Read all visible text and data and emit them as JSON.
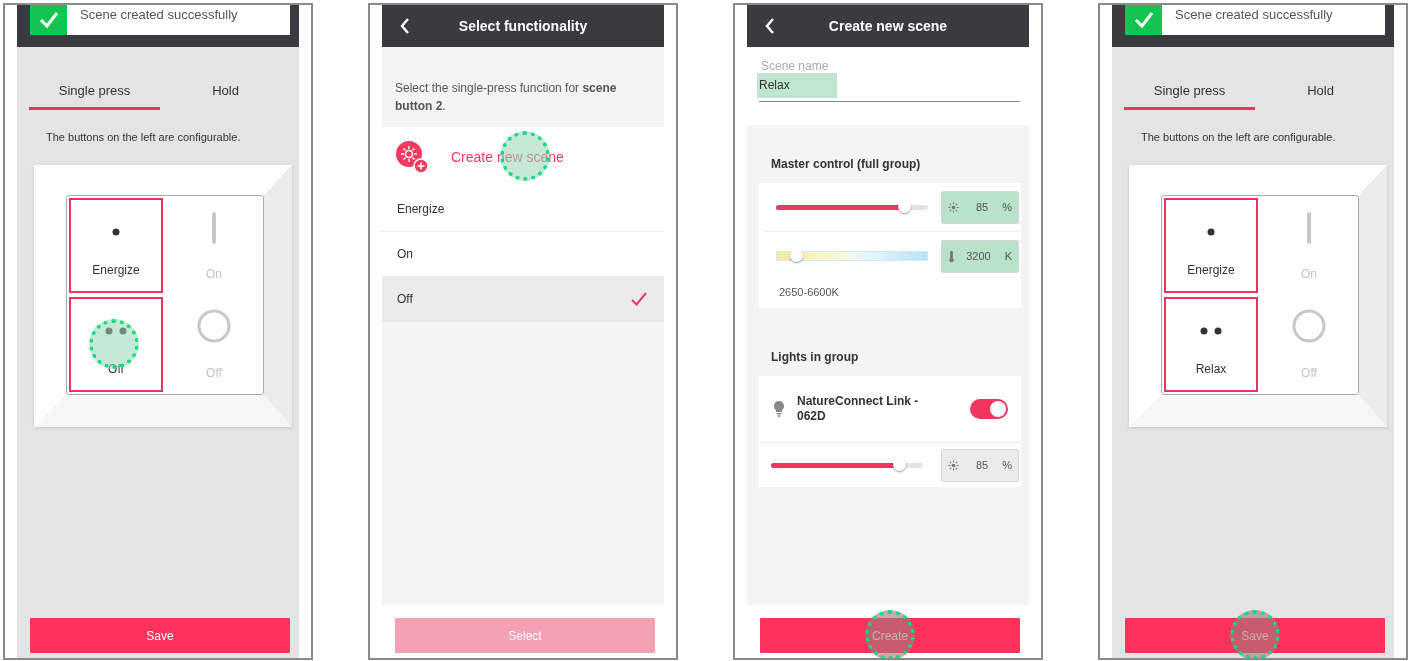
{
  "screens": [
    {
      "kind": "switch",
      "toast": {
        "text": "Scene created successfully"
      },
      "tabs": [
        {
          "label": "Single press",
          "selected": true
        },
        {
          "label": "Hold",
          "selected": false
        }
      ],
      "hint": "The buttons on the left are configurable.",
      "buttons": [
        {
          "label": "Energize",
          "kind": "dot",
          "configurable": true,
          "tapped": false
        },
        {
          "label": "On",
          "kind": "bar",
          "configurable": false,
          "tapped": false
        },
        {
          "label": "Off",
          "kind": "twodots",
          "configurable": true,
          "tapped": true
        },
        {
          "label": "Off",
          "kind": "ring",
          "configurable": false,
          "tapped": false
        }
      ],
      "action": {
        "label": "Save",
        "disabled": false,
        "tapped": false
      }
    },
    {
      "kind": "select",
      "title": "Select functionality",
      "prompt": "Select the single-press function for **scene button 2**.",
      "create": {
        "label": "Create new scene",
        "tapped": true
      },
      "options": [
        {
          "label": "Energize",
          "selected": false
        },
        {
          "label": "On",
          "selected": false
        },
        {
          "label": "Off",
          "selected": true
        }
      ],
      "action": {
        "label": "Select",
        "disabled": true,
        "tapped": false
      }
    },
    {
      "kind": "create",
      "title": "Create new scene",
      "name_field": {
        "label": "Scene name",
        "value": "Relax",
        "highlighted": true
      },
      "master": {
        "heading": "Master control (full group)",
        "brightness": {
          "level": 0.85,
          "value": "85",
          "unit": "%",
          "highlighted": true
        },
        "temperature": {
          "level": 0.13,
          "value": "3200",
          "unit": "K",
          "highlighted": true
        },
        "range": "2650-6600K"
      },
      "lights": {
        "heading": "Lights in group",
        "items": [
          {
            "name": "NatureConnect Link - 062D",
            "on": true,
            "level": 0.85,
            "value": "85",
            "unit": "%"
          }
        ]
      },
      "action": {
        "label": "Create",
        "disabled": false,
        "tapped": true
      }
    },
    {
      "kind": "switch",
      "toast": {
        "text": "Scene created successfully"
      },
      "tabs": [
        {
          "label": "Single press",
          "selected": true
        },
        {
          "label": "Hold",
          "selected": false
        }
      ],
      "hint": "The buttons on the left are configurable.",
      "buttons": [
        {
          "label": "Energize",
          "kind": "dot",
          "configurable": true,
          "tapped": false
        },
        {
          "label": "On",
          "kind": "bar",
          "configurable": false,
          "tapped": false
        },
        {
          "label": "Relax",
          "kind": "twodots",
          "configurable": true,
          "tapped": false
        },
        {
          "label": "Off",
          "kind": "ring",
          "configurable": false,
          "tapped": false
        }
      ],
      "action": {
        "label": "Save",
        "disabled": false,
        "tapped": true
      }
    }
  ]
}
